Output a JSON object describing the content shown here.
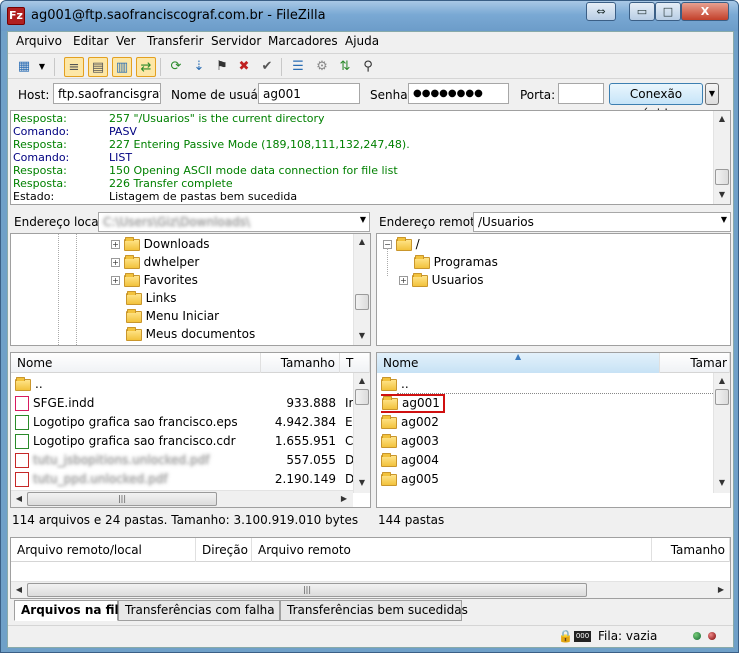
{
  "window": {
    "title": "ag001@ftp.saofranciscograf.com.br - FileZilla",
    "app_icon": "Fz",
    "minimize": "▭",
    "maximize": "□",
    "close": "X",
    "restore": "⇔"
  },
  "menu": [
    "Arquivo",
    "Editar",
    "Ver",
    "Transferir",
    "Servidor",
    "Marcadores",
    "Ajuda"
  ],
  "quickconnect": {
    "host_label": "Host:",
    "host_value": "ftp.saofrancisgraf.",
    "user_label": "Nome de usuário:",
    "user_value": "ag001",
    "pass_label": "Senha:",
    "pass_value": "●●●●●●●●",
    "port_label": "Porta:",
    "port_value": "",
    "button": "Conexão rápida",
    "dropdown": "▼"
  },
  "log": [
    {
      "k": "Resposta:",
      "m": "257 \"/Usuarios\" is the current directory",
      "color": "#008000"
    },
    {
      "k": "Comando:",
      "m": "PASV",
      "color": "#000080"
    },
    {
      "k": "Resposta:",
      "m": "227 Entering Passive Mode (189,108,111,132,247,48).",
      "color": "#008000"
    },
    {
      "k": "Comando:",
      "m": "LIST",
      "color": "#000080"
    },
    {
      "k": "Resposta:",
      "m": "150 Opening ASCII mode data connection for file list",
      "color": "#008000"
    },
    {
      "k": "Resposta:",
      "m": "226 Transfer complete",
      "color": "#008000"
    },
    {
      "k": "Estado:",
      "m": "Listagem de pastas bem sucedida",
      "color": "#000000"
    }
  ],
  "local": {
    "addr_label": "Endereço local:",
    "addr_value": "C:\\Users\\Giz\\Downloads\\",
    "tree": [
      "Downloads",
      "dwhelper",
      "Favorites",
      "Links",
      "Menu Iniciar",
      "Meus documentos"
    ],
    "headers": [
      "Nome",
      "Tamanho",
      "T"
    ],
    "files": [
      {
        "name": "..",
        "size": "",
        "type": ""
      },
      {
        "name": "SFGE.indd",
        "size": "933.888",
        "type": "Ir"
      },
      {
        "name": "Logotipo grafica sao francisco.eps",
        "size": "4.942.384",
        "type": "E"
      },
      {
        "name": "Logotipo grafica sao francisco.cdr",
        "size": "1.655.951",
        "type": "C"
      },
      {
        "name": "tutu_jsbopitions.unlocked.pdf",
        "size": "557.055",
        "type": "D"
      },
      {
        "name": "tutu_ppd.unlocked.pdf",
        "size": "2.190.149",
        "type": "D"
      }
    ],
    "status": "114 arquivos e 24 pastas. Tamanho: 3.100.919.010 bytes"
  },
  "remote": {
    "addr_label": "Endereço remoto:",
    "addr_value": "/Usuarios",
    "tree_root": "/",
    "tree": [
      "Programas",
      "Usuarios"
    ],
    "headers": [
      "Nome",
      "Tamar"
    ],
    "folders": [
      "..",
      "ag001",
      "ag002",
      "ag003",
      "ag004",
      "ag005"
    ],
    "highlighted": "ag001",
    "status": "144 pastas"
  },
  "queue": {
    "headers": [
      "Arquivo remoto/local",
      "Direção",
      "Arquivo remoto",
      "Tamanho"
    ]
  },
  "tabs": [
    "Arquivos na fila",
    "Transferências com falha",
    "Transferências bem sucedidas"
  ],
  "statusbar": {
    "queue": "Fila: vazia"
  },
  "colors": {
    "highlight_border": "#d01010",
    "response": "#008000",
    "command": "#000080"
  }
}
